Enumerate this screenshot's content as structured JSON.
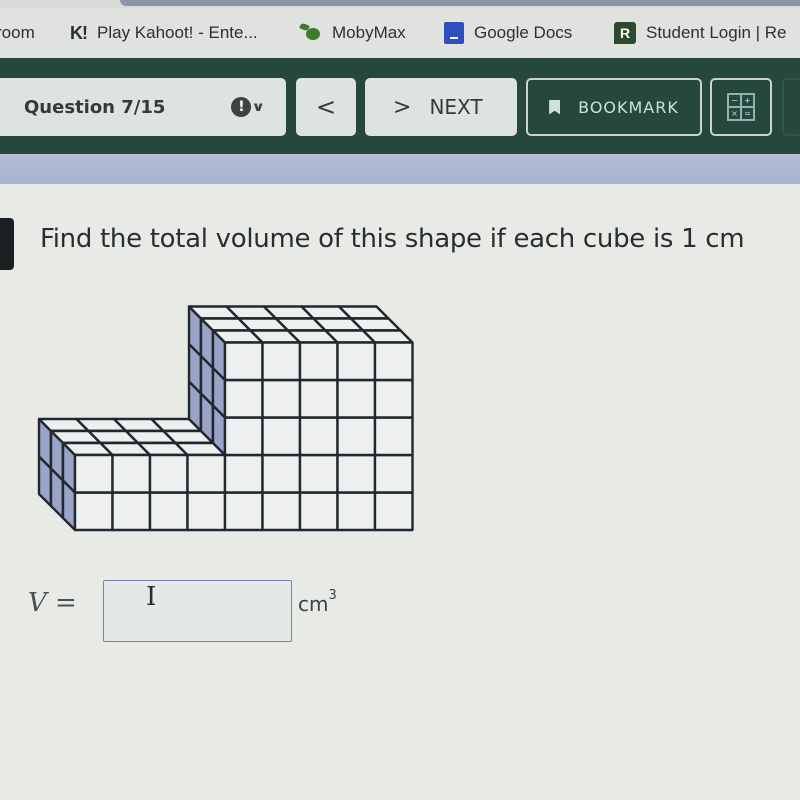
{
  "browser": {
    "bookmarks": [
      {
        "label": "room",
        "icon": "none"
      },
      {
        "label": "Play Kahoot! - Ente...",
        "icon": "kahoot-icon",
        "icon_text": "K!"
      },
      {
        "label": "MobyMax",
        "icon": "mobymax-icon"
      },
      {
        "label": "Google Docs",
        "icon": "google-docs-icon"
      },
      {
        "label": "Student Login | Re",
        "icon": "r-icon",
        "icon_text": "R"
      }
    ]
  },
  "toolbar": {
    "question_label": "Question 7/15",
    "flag_icon_text": "!",
    "chevron_text": "∨",
    "prev_label": "<",
    "next_arrow": ">",
    "next_label": "NEXT",
    "bookmark_label": "BOOKMARK",
    "calculator_keys": [
      "−",
      "+",
      "×",
      "="
    ]
  },
  "question": {
    "prompt": "Find the total volume of this shape if each cube is 1 cm",
    "figure": {
      "description": "Isometric unit-cube solid",
      "lower_block": {
        "width": 4,
        "height": 2,
        "depth": 3
      },
      "tall_block": {
        "width": 5,
        "height": 5,
        "depth": 3
      }
    },
    "answer": {
      "variable": "V",
      "equals": "=",
      "value": "",
      "placeholder": "",
      "unit": "cm",
      "unit_exponent": "3"
    }
  },
  "colors": {
    "toolbar_green": "#25473c",
    "cube_face": "#eef0f0",
    "cube_side": "#9aa3c8",
    "cube_edge": "#23272e",
    "input_border": "#6e87ad"
  }
}
